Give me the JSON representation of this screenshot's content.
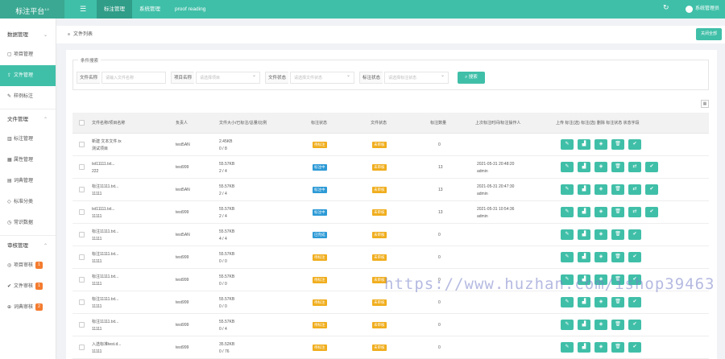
{
  "header": {
    "logo": "标注平台",
    "logo_version": "1.0",
    "menu_icon": "menu-icon",
    "nav": [
      "标注管理",
      "系统管理",
      "proof reading"
    ],
    "refresh_icon": "refresh-icon",
    "user": "系统管理员"
  },
  "sidebar": {
    "groups": [
      {
        "label": "数据管理",
        "items": [
          {
            "label": "项目管理",
            "icon": "file-icon"
          },
          {
            "label": "文件管理",
            "icon": "upload-icon"
          },
          {
            "label": "样例标注",
            "icon": "edit-icon"
          }
        ]
      },
      {
        "label": "文件管理",
        "items": [
          {
            "label": "标注管理",
            "icon": "chart-icon"
          },
          {
            "label": "属性管理",
            "icon": "grid-icon"
          },
          {
            "label": "词典管理",
            "icon": "book-icon"
          },
          {
            "label": "标准分类",
            "icon": "tag-icon"
          },
          {
            "label": "常识数据",
            "icon": "clock-icon"
          }
        ]
      },
      {
        "label": "审核管理",
        "items": [
          {
            "label": "项目审核",
            "icon": "circle-check-icon",
            "badge": "1"
          },
          {
            "label": "文件审核",
            "icon": "check-icon",
            "badge": "1"
          },
          {
            "label": "词典审核",
            "icon": "globe-icon",
            "badge": "2"
          }
        ]
      }
    ]
  },
  "tabs": {
    "current": "文件列表",
    "close_all": "关闭全部"
  },
  "filter": {
    "title": "条件搜索",
    "fields": [
      {
        "label": "文件名称",
        "placeholder": "请输入文件名称"
      },
      {
        "label": "项目名称",
        "placeholder": "请选择项目"
      },
      {
        "label": "文件状态",
        "placeholder": "请选择文件状态"
      },
      {
        "label": "标注状态",
        "placeholder": "请选择标注状态"
      }
    ],
    "search_button": "搜索"
  },
  "table": {
    "columns": [
      "文件名称/项目名称",
      "负责人",
      "文件大小/已标注/总量/比例",
      "标注状态",
      "文件状态",
      "标注数量",
      "上次标注时间/标注操作人",
      "操作"
    ],
    "op_labels": "上传   标注(选)   标注(选)   删除   标注状态   状态字段",
    "rows": [
      {
        "name": "新建 文本文件.tx",
        "project": "测试项目",
        "owner": "test5AN",
        "size": "2.45KB",
        "progress": "0 / 8",
        "tag": "待标注",
        "tag_color": "#f0ad1c",
        "status": "未审核",
        "status_color": "#f0ad1c",
        "count": "0",
        "time": "",
        "operator": ""
      },
      {
        "name": "txt11111.txt...",
        "project": "222",
        "owner": "test999",
        "size": "55.57KB",
        "progress": "2 / 4",
        "tag": "标注中",
        "tag_color": "#2d9ad6",
        "status": "未审核",
        "status_color": "#f0ad1c",
        "count": "13",
        "time": "2021-05-31 20:48:20",
        "operator": "admin"
      },
      {
        "name": "标注11111.txt...",
        "project": "11111",
        "owner": "test5AN",
        "size": "55.57KB",
        "progress": "2 / 4",
        "tag": "标注中",
        "tag_color": "#2d9ad6",
        "status": "未审核",
        "status_color": "#f0ad1c",
        "count": "13",
        "time": "2021-05-31 20:47:30",
        "operator": "admin"
      },
      {
        "name": "txt11111.txt...",
        "project": "11111",
        "owner": "test999",
        "size": "55.57KB",
        "progress": "2 / 4",
        "tag": "标注中",
        "tag_color": "#2d9ad6",
        "status": "未审核",
        "status_color": "#f0ad1c",
        "count": "13",
        "time": "2021-05-31 10:54:36",
        "operator": "admin"
      },
      {
        "name": "标注11111.txt...",
        "project": "11111",
        "owner": "test5AN",
        "size": "55.57KB",
        "progress": "4 / 4",
        "tag": "已完成",
        "tag_color": "#2d9ad6",
        "status": "未审核",
        "status_color": "#f0ad1c",
        "count": "0",
        "time": "",
        "operator": ""
      },
      {
        "name": "标注11111.txt...",
        "project": "11111",
        "owner": "test999",
        "size": "55.57KB",
        "progress": "0 / 0",
        "tag": "待标注",
        "tag_color": "#f0ad1c",
        "status": "未审核",
        "status_color": "#f0ad1c",
        "count": "0",
        "time": "",
        "operator": ""
      },
      {
        "name": "标注11111.txt...",
        "project": "11111",
        "owner": "test999",
        "size": "55.57KB",
        "progress": "0 / 0",
        "tag": "待标注",
        "tag_color": "#f0ad1c",
        "status": "未审核",
        "status_color": "#f0ad1c",
        "count": "0",
        "time": "",
        "operator": ""
      },
      {
        "name": "标注11111.txt...",
        "project": "11111",
        "owner": "test999",
        "size": "55.57KB",
        "progress": "0 / 0",
        "tag": "待标注",
        "tag_color": "#f0ad1c",
        "status": "未审核",
        "status_color": "#f0ad1c",
        "count": "0",
        "time": "",
        "operator": ""
      },
      {
        "name": "标注11111.txt...",
        "project": "11111",
        "owner": "test999",
        "size": "55.57KB",
        "progress": "0 / 4",
        "tag": "待标注",
        "tag_color": "#f0ad1c",
        "status": "未审核",
        "status_color": "#f0ad1c",
        "count": "0",
        "time": "",
        "operator": ""
      },
      {
        "name": "入选标准test.d...",
        "project": "11111",
        "owner": "test999",
        "size": "35.52KB",
        "progress": "0 / 76",
        "tag": "待标注",
        "tag_color": "#f0ad1c",
        "status": "未审核",
        "status_color": "#f0ad1c",
        "count": "0",
        "time": "",
        "operator": ""
      }
    ]
  },
  "watermark": "https://www.huzhan.com/ishop39463",
  "colors": {
    "accent": "#40bfa8",
    "warning": "#f0ad1c",
    "info": "#2d9ad6",
    "badge": "#f47c30"
  }
}
